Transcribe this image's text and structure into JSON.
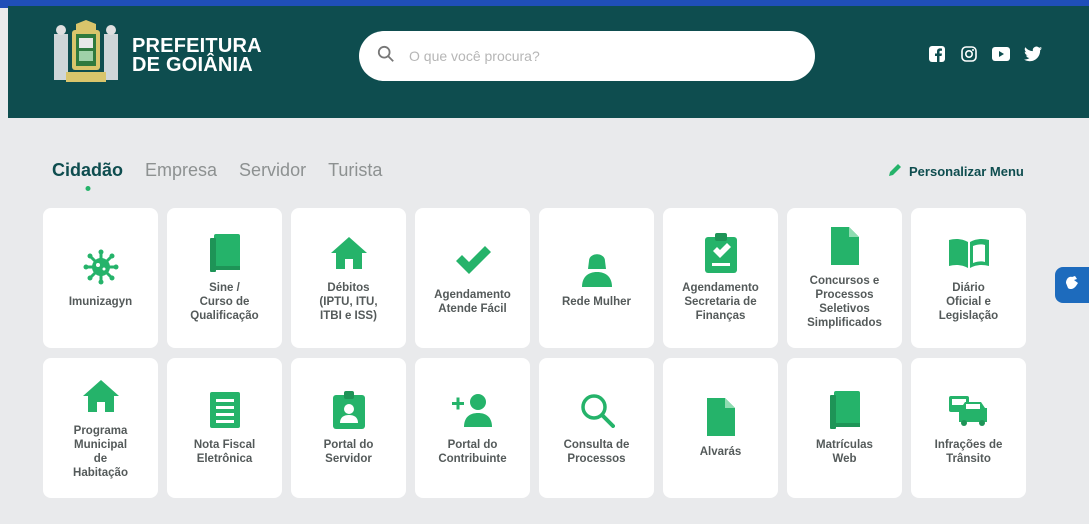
{
  "header": {
    "brand_line1": "PREFEITURA",
    "brand_line2": "DE GOIÂNIA",
    "logo_icon": "coat-of-arms-icon",
    "bg_color": "#0e4d4f"
  },
  "search": {
    "placeholder": "O que você procura?",
    "value": ""
  },
  "social": [
    "facebook-icon",
    "instagram-icon",
    "youtube-icon",
    "twitter-icon"
  ],
  "tabs": [
    {
      "label": "Cidadão",
      "active": true
    },
    {
      "label": "Empresa",
      "active": false
    },
    {
      "label": "Servidor",
      "active": false
    },
    {
      "label": "Turista",
      "active": false
    }
  ],
  "personalize_label": "Personalizar Menu",
  "accent_color": "#25b36a",
  "cards": [
    {
      "label": "Imunizagyn",
      "icon": "virus-icon"
    },
    {
      "label": "Sine /\nCurso de\nQualificação",
      "icon": "book-icon"
    },
    {
      "label": "Débitos\n(IPTU, ITU,\nITBI e ISS)",
      "icon": "home-icon"
    },
    {
      "label": "Agendamento\nAtende Fácil",
      "icon": "check-icon"
    },
    {
      "label": "Rede Mulher",
      "icon": "woman-icon"
    },
    {
      "label": "Agendamento\nSecretaria de\nFinanças",
      "icon": "clipboard-check-icon"
    },
    {
      "label": "Concursos e\nProcessos\nSeletivos\nSimplificados",
      "icon": "file-icon"
    },
    {
      "label": "Diário\nOficial e\nLegislação",
      "icon": "open-book-icon"
    },
    {
      "label": "Programa\nMunicipal\nde\nHabitação",
      "icon": "home-icon"
    },
    {
      "label": "Nota Fiscal\nEletrônica",
      "icon": "receipt-icon"
    },
    {
      "label": "Portal do\nServidor",
      "icon": "id-badge-icon"
    },
    {
      "label": "Portal do\nContribuinte",
      "icon": "user-plus-icon"
    },
    {
      "label": "Consulta de\nProcessos",
      "icon": "magnifier-icon"
    },
    {
      "label": "Alvarás",
      "icon": "file-icon"
    },
    {
      "label": "Matrículas\nWeb",
      "icon": "book-icon"
    },
    {
      "label": "Infrações de\nTrânsito",
      "icon": "car-icon"
    }
  ],
  "accessibility_icon": "sign-language-icon"
}
